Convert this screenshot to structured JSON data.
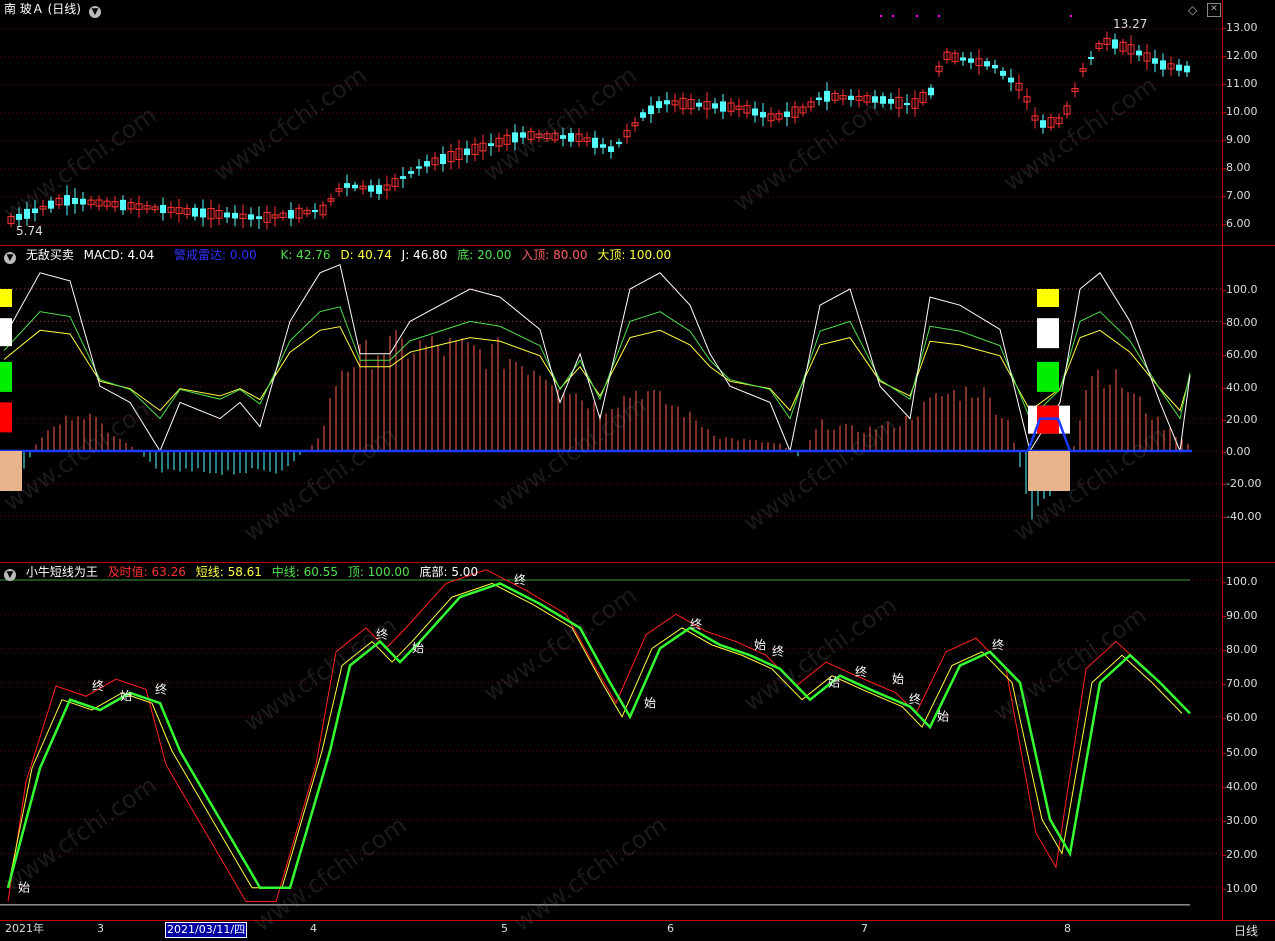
{
  "top": {
    "title": "南 玻Ａ (日线)",
    "high_label": "13.27",
    "low_label": "5.74",
    "yticks": [
      "13.00",
      "12.00",
      "11.00",
      "10.00",
      "9.00",
      "8.00",
      "7.00",
      "6.00"
    ]
  },
  "mid": {
    "name": "无敌买卖",
    "macd": "MACD: 4.04",
    "radar": "警戒雷达: 0.00",
    "k": "K: 42.76",
    "d": "D: 40.74",
    "j": "J: 46.80",
    "di": "底: 20.00",
    "ru": "入顶: 80.00",
    "da": "大顶: 100.00",
    "yticks": [
      "100.0",
      "80.00",
      "60.00",
      "40.00",
      "20.00",
      "0.00",
      "-20.00",
      "-40.00"
    ]
  },
  "bottom": {
    "name": "小牛短线为王",
    "jishi": "及时值: 63.26",
    "duan": "短线: 58.61",
    "zhong": "中线: 60.55",
    "ding": "顶: 100.00",
    "dibu": "底部: 5.00",
    "yticks": [
      "100.0",
      "90.00",
      "80.00",
      "70.00",
      "60.00",
      "50.00",
      "40.00",
      "30.00",
      "20.00",
      "10.00"
    ],
    "marks": [
      "始",
      "终",
      "始",
      "终",
      "终",
      "始",
      "终",
      "始",
      "终",
      "始",
      "终",
      "始",
      "终",
      "始",
      "终",
      "始",
      "终"
    ]
  },
  "xaxis": {
    "labels": [
      "2021年",
      "3",
      "2021/03/11/四",
      "4",
      "5",
      "6",
      "7",
      "8"
    ],
    "period": "日线"
  },
  "watermark": "www.cfchi.com",
  "colors": {
    "up": "#ff3333",
    "down": "#54ffff",
    "grid": "#7a0000",
    "accent": "#c00000"
  }
}
